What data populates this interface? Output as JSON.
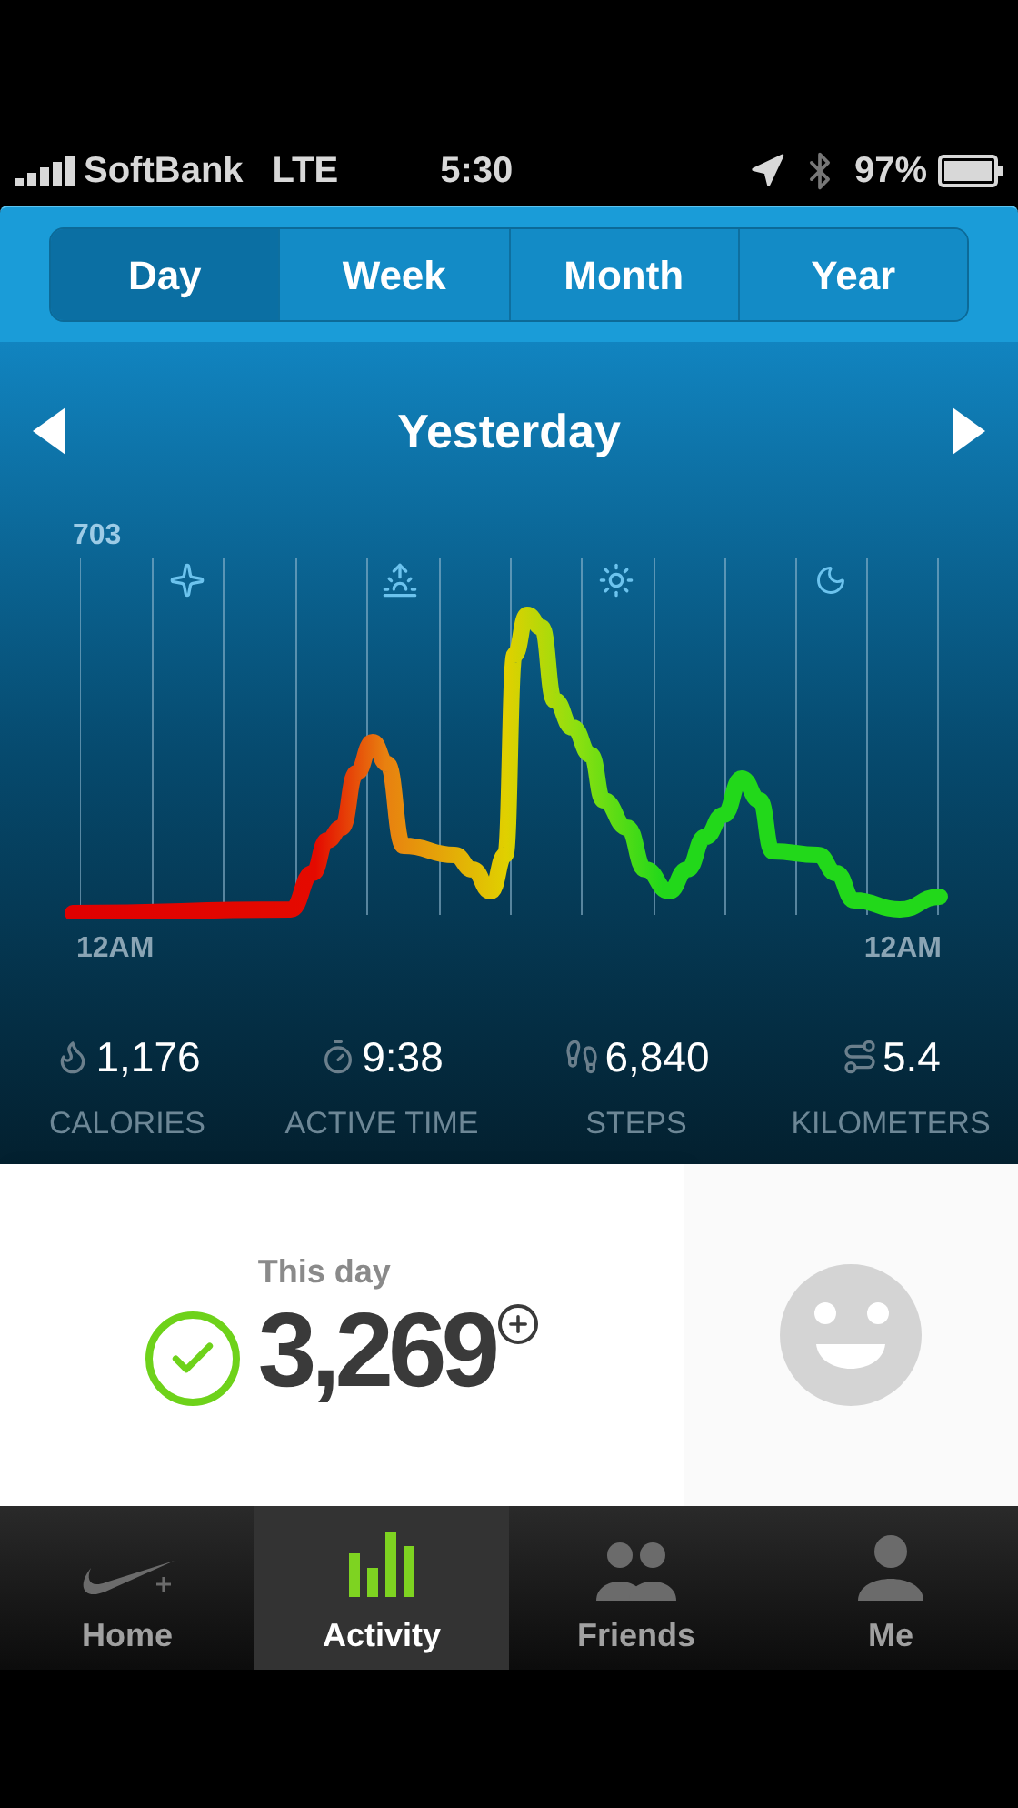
{
  "status_bar": {
    "carrier": "SoftBank",
    "network": "LTE",
    "time": "5:30",
    "battery": "97%"
  },
  "tabs": [
    {
      "label": "Day",
      "selected": true
    },
    {
      "label": "Week",
      "selected": false
    },
    {
      "label": "Month",
      "selected": false
    },
    {
      "label": "Year",
      "selected": false
    }
  ],
  "date_nav": {
    "title": "Yesterday"
  },
  "chart": {
    "max_label": "703",
    "start_label": "12AM",
    "end_label": "12AM"
  },
  "stats": [
    {
      "kind": "calories",
      "value": "1,176",
      "label": "CALORIES"
    },
    {
      "kind": "time",
      "value": "9:38",
      "label": "ACTIVE TIME"
    },
    {
      "kind": "steps",
      "value": "6,840",
      "label": "STEPS"
    },
    {
      "kind": "distance",
      "value": "5.4",
      "label": "KILOMETERS"
    }
  ],
  "summary": {
    "caption": "This day",
    "fuel": "3,269",
    "goal_met": true
  },
  "nav": [
    {
      "kind": "home",
      "label": "Home",
      "selected": false
    },
    {
      "kind": "activity",
      "label": "Activity",
      "selected": true
    },
    {
      "kind": "friends",
      "label": "Friends",
      "selected": false
    },
    {
      "kind": "me",
      "label": "Me",
      "selected": false
    }
  ]
}
